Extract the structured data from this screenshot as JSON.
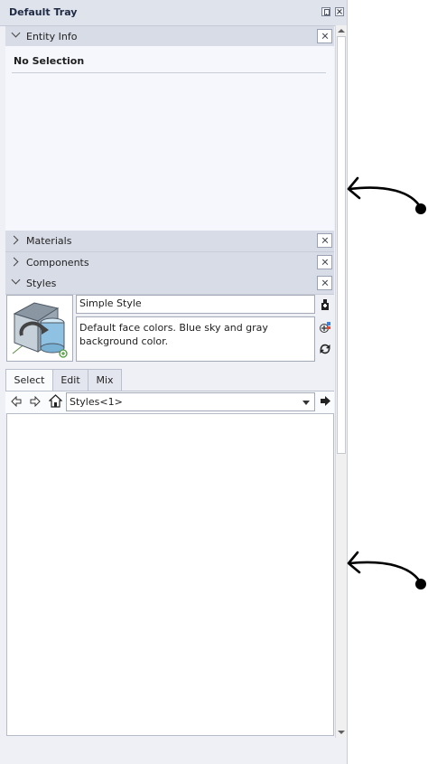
{
  "tray": {
    "title": "Default Tray"
  },
  "panels": {
    "entity_info": {
      "label": "Entity Info",
      "status": "No Selection"
    },
    "materials": {
      "label": "Materials"
    },
    "components": {
      "label": "Components"
    },
    "styles": {
      "label": "Styles",
      "style_name": "Simple Style",
      "style_description": "Default face colors. Blue sky and gray background color.",
      "tabs": [
        {
          "label": "Select",
          "active": true
        },
        {
          "label": "Edit",
          "active": false
        },
        {
          "label": "Mix",
          "active": false
        }
      ],
      "collection": "Styles<1>"
    }
  },
  "colors": {
    "panel_header": "#d8dce6",
    "tray_background": "#eef0f5",
    "annotation_arrow": "#000000"
  },
  "icons": [
    "pin-icon",
    "close-icon",
    "chevron-down-icon",
    "chevron-right-icon",
    "create-style-icon",
    "update-style-icon",
    "refresh-icon",
    "back-arrow-icon",
    "forward-arrow-icon",
    "home-icon",
    "details-arrow-icon"
  ]
}
